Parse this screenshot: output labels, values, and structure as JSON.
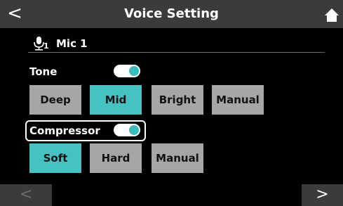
{
  "header": {
    "title": "Voice Setting",
    "back_symbol": "<",
    "home_icon": "home-icon"
  },
  "mic": {
    "subscript": "1",
    "label": "Mic 1",
    "icon": "microphone-icon"
  },
  "tone": {
    "label": "Tone",
    "enabled": true,
    "options": [
      {
        "label": "Deep",
        "selected": false
      },
      {
        "label": "Mid",
        "selected": true
      },
      {
        "label": "Bright",
        "selected": false
      },
      {
        "label": "Manual",
        "selected": false
      }
    ]
  },
  "compressor": {
    "label": "Compressor",
    "enabled": true,
    "options": [
      {
        "label": "Soft",
        "selected": true
      },
      {
        "label": "Hard",
        "selected": false
      },
      {
        "label": "Manual",
        "selected": false
      }
    ]
  },
  "nav": {
    "prev_symbol": "<",
    "next_symbol": ">"
  },
  "colors": {
    "accent": "#46c2c3",
    "button": "#a6a6a6",
    "bar": "#3b3b3b",
    "background": "#000000"
  }
}
